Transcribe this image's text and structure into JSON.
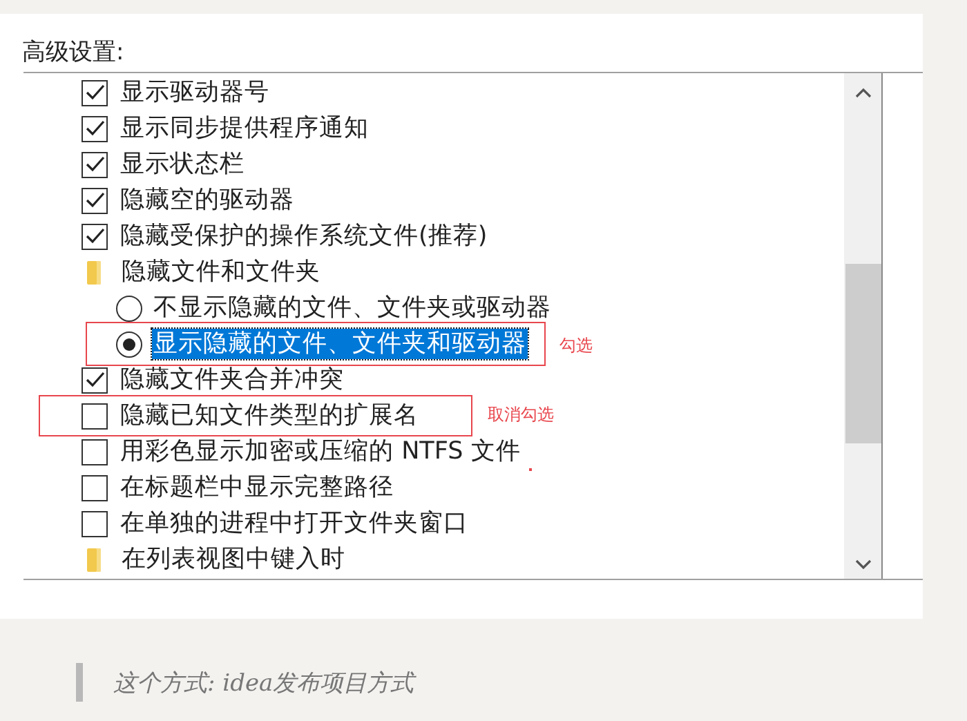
{
  "section_label": "高级设置:",
  "items": [
    {
      "kind": "checkbox",
      "label": "显示驱动器号",
      "checked": true
    },
    {
      "kind": "checkbox",
      "label": "显示同步提供程序通知",
      "checked": true
    },
    {
      "kind": "checkbox",
      "label": "显示状态栏",
      "checked": true
    },
    {
      "kind": "checkbox",
      "label": "隐藏空的驱动器",
      "checked": true
    },
    {
      "kind": "checkbox",
      "label": "隐藏受保护的操作系统文件(推荐)",
      "checked": true
    },
    {
      "kind": "folder",
      "label": "隐藏文件和文件夹",
      "children": [
        {
          "kind": "radio",
          "label": "不显示隐藏的文件、文件夹或驱动器",
          "selected": false
        },
        {
          "kind": "radio",
          "label": "显示隐藏的文件、文件夹和驱动器",
          "selected": true
        }
      ]
    },
    {
      "kind": "checkbox",
      "label": "隐藏文件夹合并冲突",
      "checked": true
    },
    {
      "kind": "checkbox",
      "label": "隐藏已知文件类型的扩展名",
      "checked": false
    },
    {
      "kind": "checkbox",
      "label": "用彩色显示加密或压缩的 NTFS 文件",
      "checked": false
    },
    {
      "kind": "checkbox",
      "label": "在标题栏中显示完整路径",
      "checked": false
    },
    {
      "kind": "checkbox",
      "label": "在单独的进程中打开文件夹窗口",
      "checked": false
    },
    {
      "kind": "folder",
      "label": "在列表视图中键入时"
    }
  ],
  "annotations": [
    {
      "text": "勾选"
    },
    {
      "text": "取消勾选"
    }
  ],
  "quote": "这个方式: idea发布项目方式"
}
